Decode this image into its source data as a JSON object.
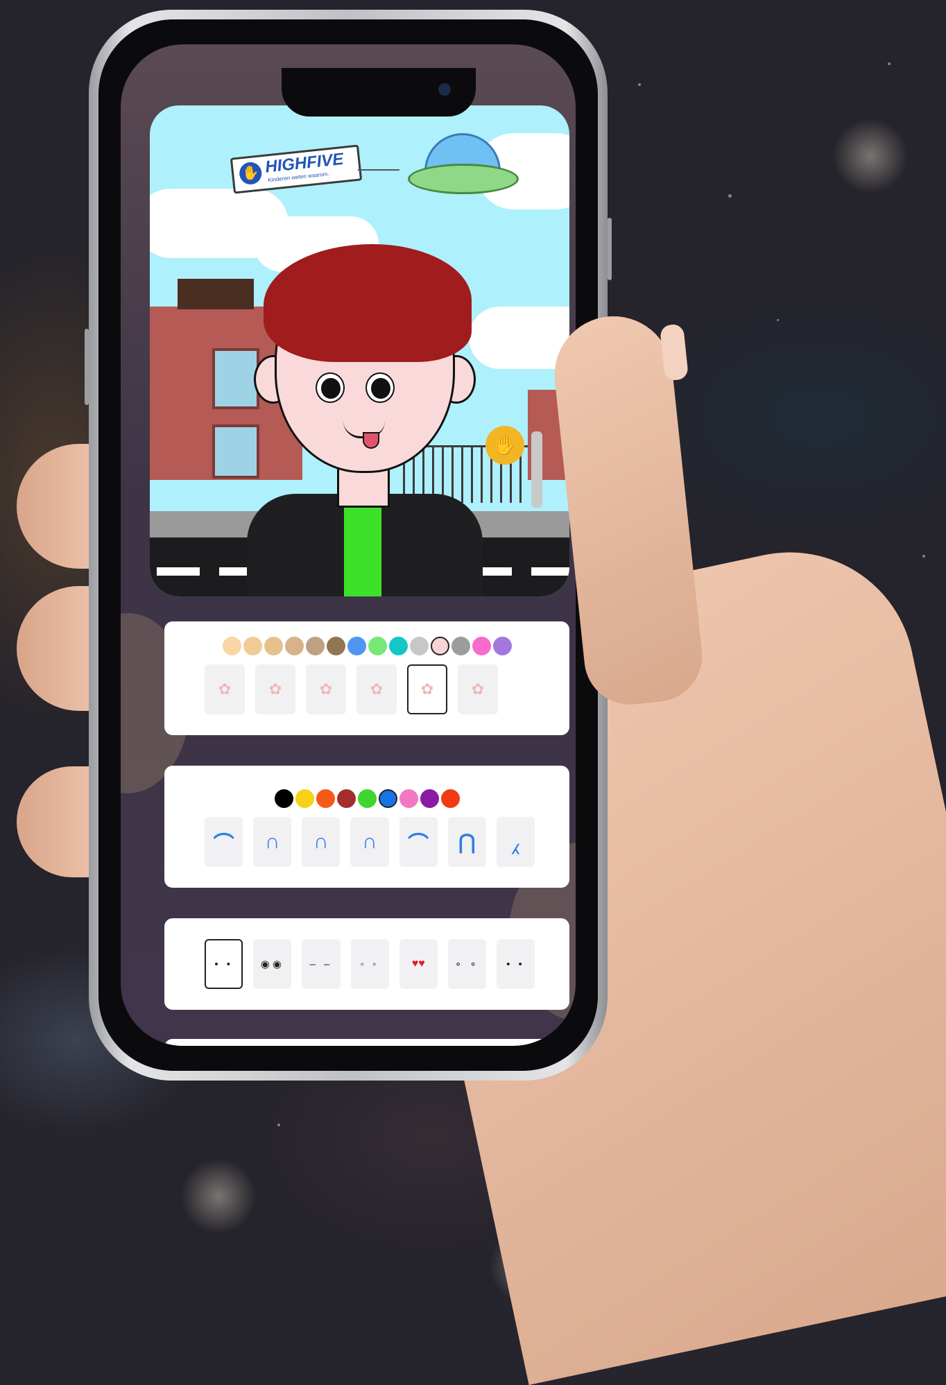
{
  "scene": {
    "banner_brand": "HIGHFIVE",
    "banner_tagline": "Kinderen weten waarom.",
    "hand_badge_icon": "hand-wave-icon"
  },
  "skin_panel": {
    "colors": [
      "#f9d6a6",
      "#f1cb96",
      "#e8c08c",
      "#d7b28a",
      "#bea181",
      "#927553",
      "#4f95f1",
      "#77e877",
      "#14c7c7",
      "#c7c7c7",
      "#f7d3d3",
      "#9c9c9c",
      "#f66bcd",
      "#a377e0"
    ],
    "selected_color_index": 10,
    "options": [
      "nose-1",
      "nose-2",
      "nose-3",
      "nose-4",
      "nose-5",
      "nose-6"
    ],
    "selected_option_index": 4
  },
  "hair_panel": {
    "colors": [
      "#000000",
      "#f6d117",
      "#f35a16",
      "#a32e2e",
      "#3ed52d",
      "#1575e7",
      "#f178c3",
      "#8a19a5",
      "#f13a16"
    ],
    "selected_color_index": 5,
    "options": [
      "hair-1",
      "hair-2",
      "hair-3",
      "hair-4",
      "hair-5",
      "hair-6",
      "hair-7"
    ],
    "glyphs": [
      "⌒",
      "∩",
      "∩",
      "∩",
      "⌒",
      "⋂",
      "⁁"
    ]
  },
  "eyes_panel": {
    "options": [
      "• •",
      "◉◉",
      "‒ ‒",
      "◦ ◦",
      "♥♥",
      "∘ ∘",
      "• •"
    ],
    "selected_option_index": 0
  }
}
